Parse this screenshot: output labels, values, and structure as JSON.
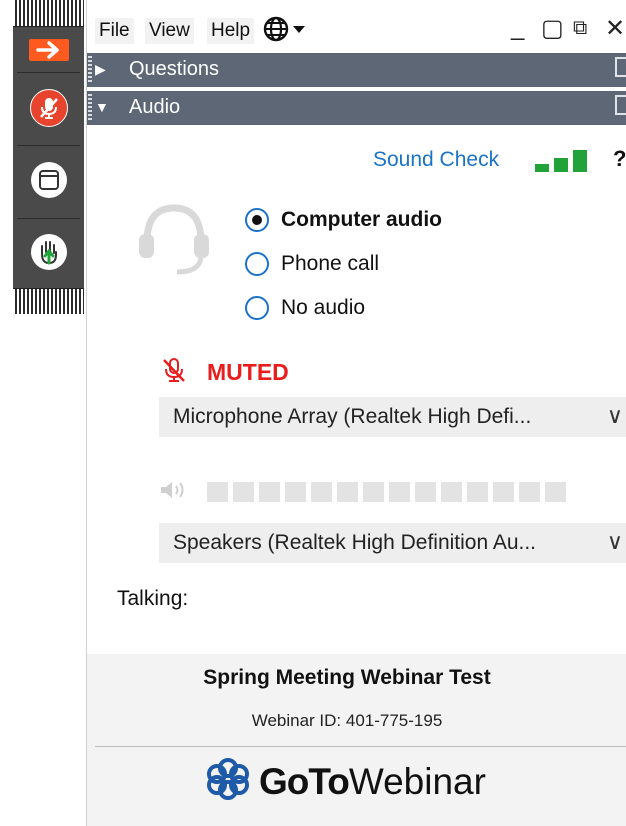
{
  "menu": {
    "file": "File",
    "view": "View",
    "help": "Help"
  },
  "window_controls": {
    "minimize": "_",
    "maximize": "▢",
    "popout": "⧉",
    "close": "✕"
  },
  "sections": {
    "questions": "Questions",
    "audio": "Audio"
  },
  "sound_check": {
    "label": "Sound Check",
    "help": "?"
  },
  "audio_options": [
    {
      "label": "Computer audio",
      "selected": true
    },
    {
      "label": "Phone call",
      "selected": false
    },
    {
      "label": "No audio",
      "selected": false
    }
  ],
  "mic": {
    "status": "MUTED",
    "device": "Microphone Array (Realtek High Defi..."
  },
  "speaker": {
    "device": "Speakers (Realtek High Definition Au..."
  },
  "talking_label": "Talking:",
  "meeting": {
    "title": "Spring Meeting Webinar Test",
    "webinar_id": "Webinar ID: 401-775-195"
  },
  "brand": {
    "goto": "GoTo",
    "webinar": "Webinar"
  },
  "colors": {
    "accent_orange": "#ff5a1f",
    "muted_red": "#e81e1e",
    "link_blue": "#1a73c9",
    "section_bar": "#5d6775",
    "meter_green": "#22a33a"
  },
  "icons": [
    "arrow-right-icon",
    "mic-off-icon",
    "window-icon",
    "raise-hand-icon",
    "globe-icon",
    "headset-icon",
    "speaker-icon",
    "gotowebinar-logo-icon"
  ]
}
